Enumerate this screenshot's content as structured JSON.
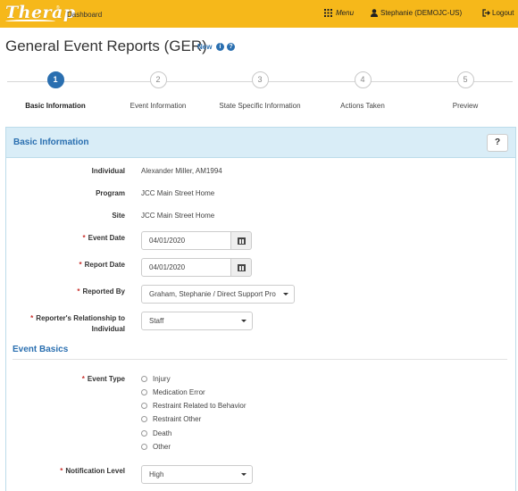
{
  "topbar": {
    "logo": "Therap",
    "tm": "®",
    "dashboard": "Dashboard",
    "menu": "Menu",
    "user": "Stephanie (DEMOJC-US)",
    "logout": "Logout"
  },
  "page": {
    "title": "General Event Reports (GER)",
    "new_label": "New"
  },
  "steps": [
    {
      "num": "1",
      "label": "Basic Information"
    },
    {
      "num": "2",
      "label": "Event Information"
    },
    {
      "num": "3",
      "label": "State Specific Information"
    },
    {
      "num": "4",
      "label": "Actions Taken"
    },
    {
      "num": "5",
      "label": "Preview"
    }
  ],
  "panel": {
    "title": "Basic Information",
    "help": "?"
  },
  "form": {
    "individual_label": "Individual",
    "individual_value": "Alexander Miller, AM1994",
    "program_label": "Program",
    "program_value": "JCC Main Street Home",
    "site_label": "Site",
    "site_value": "JCC Main Street Home",
    "event_date_label": "Event Date",
    "event_date_value": "04/01/2020",
    "report_date_label": "Report Date",
    "report_date_value": "04/01/2020",
    "reported_by_label": "Reported By",
    "reported_by_value": "Graham, Stephanie / Direct Support Pro",
    "relationship_label_1": "Reporter's Relationship to",
    "relationship_label_2": "Individual",
    "relationship_value": "Staff",
    "required_mark": "*"
  },
  "event_basics": {
    "title": "Event Basics",
    "event_type_label": "Event Type",
    "event_types": [
      "Injury",
      "Medication Error",
      "Restraint Related to Behavior",
      "Restraint Other",
      "Death",
      "Other"
    ],
    "notification_label": "Notification Level",
    "notification_value": "High"
  }
}
